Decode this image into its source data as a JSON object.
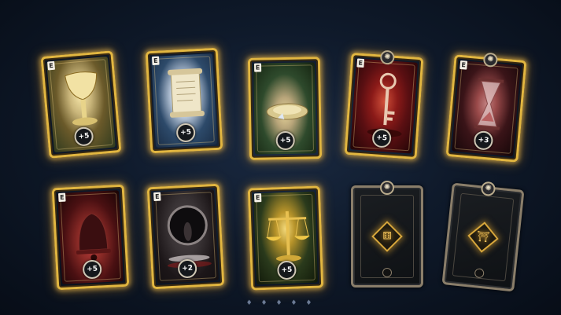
{
  "cards": [
    {
      "state": "face",
      "theme": "golden-chalice",
      "corner_label": "E",
      "value": "+5",
      "art_colors": [
        "#6b5a2a",
        "#c9b57a",
        "#2e3a1e"
      ]
    },
    {
      "state": "face",
      "theme": "ancient-scroll",
      "corner_label": "E",
      "value": "+5",
      "art_colors": [
        "#2d4a6a",
        "#e6dcc0",
        "#1a2c44"
      ]
    },
    {
      "state": "face",
      "theme": "offering-dish",
      "corner_label": "E",
      "value": "+5",
      "art_colors": [
        "#2e4a2c",
        "#b8a57a",
        "#14220f"
      ]
    },
    {
      "state": "face",
      "theme": "crimson-key",
      "corner_label": "E",
      "value": "+5",
      "art_colors": [
        "#5a0f12",
        "#c23a2a",
        "#200506"
      ]
    },
    {
      "state": "face",
      "theme": "hourglass",
      "corner_label": "E",
      "value": "+3",
      "art_colors": [
        "#3a1418",
        "#9a4a4a",
        "#140608"
      ]
    },
    {
      "state": "face",
      "theme": "iron-bell",
      "corner_label": "E",
      "value": "+5",
      "art_colors": [
        "#4a1012",
        "#8a2a26",
        "#180405"
      ]
    },
    {
      "state": "face",
      "theme": "dark-portal",
      "corner_label": "E",
      "value": "+2",
      "art_colors": [
        "#3a3436",
        "#9a9090",
        "#141012"
      ]
    },
    {
      "state": "face",
      "theme": "golden-scales",
      "corner_label": "E",
      "value": "+5",
      "art_colors": [
        "#2a3a1c",
        "#e0b84a",
        "#101808"
      ]
    },
    {
      "state": "back",
      "theme": "die-sigil",
      "symbol": "⚅"
    },
    {
      "state": "back",
      "theme": "shrine-sigil",
      "symbol": "⛩"
    }
  ],
  "pager_glyphs": "♦ ♦ ♦ ♦ ♦"
}
